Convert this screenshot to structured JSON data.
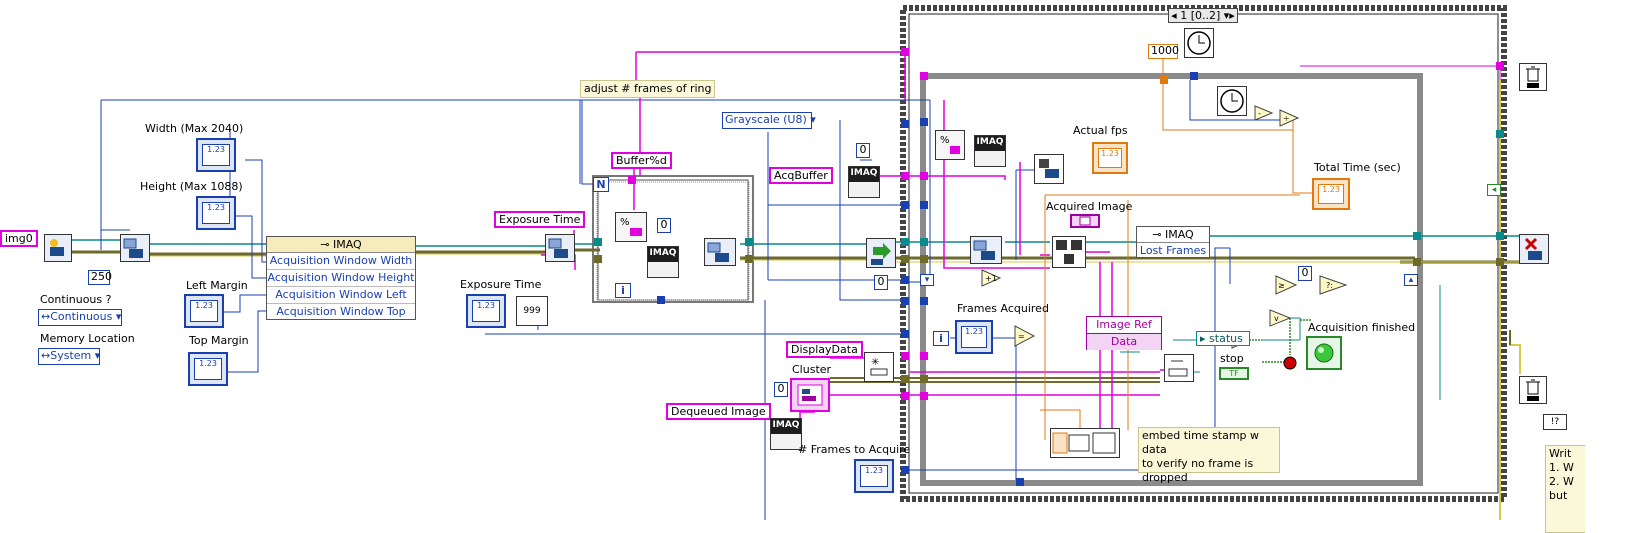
{
  "constants": {
    "img0": "img0",
    "n250": "250",
    "continuous": "Continuous",
    "memory": "System",
    "adjust_frames": "adjust # frames of ring",
    "buffer_fmt": "Buffer%d",
    "exposure_time_const": "Exposure Time",
    "grayscale": "Grayscale (U8)",
    "acq_buffer": "AcqBuffer",
    "display_data": "DisplayData",
    "dequeued_image": "Dequeued Image",
    "zero_a": "0",
    "zero_b": "0",
    "zero_c": "0",
    "zero_d": "0",
    "zero_e": "0",
    "n1000": "1000",
    "case_selector": "1 [0..2]",
    "stop_bool": "TF",
    "n999": "999"
  },
  "labels": {
    "width": "Width (Max 2040)",
    "height": "Height (Max 1088)",
    "left_margin": "Left Margin",
    "top_margin": "Top Margin",
    "continuous_q": "Continuous ?",
    "memory_location": "Memory Location",
    "exposure_time": "Exposure Time",
    "actual_fps": "Actual fps",
    "total_time": "Total Time (sec)",
    "acquired_image": "Acquired Image",
    "frames_acquired": "Frames Acquired",
    "acq_finished": "Acquisition finished",
    "stop": "stop",
    "status": "status",
    "cluster": "Cluster",
    "frames_to_acquire": "# Frames to Acquire"
  },
  "property_node": {
    "title": "IMAQ",
    "rows": [
      "Acquisition Window Width",
      "Acquisition Window Height",
      "Acquisition Window Left",
      "Acquisition Window Top"
    ]
  },
  "lost_frames_node": {
    "title": "IMAQ",
    "row": "Lost Frames"
  },
  "unbundle": {
    "image_ref": "Image Ref",
    "data": "Data"
  },
  "comments": {
    "timestamp": "embed time stamp w  data\nto verify no frame is\ndropped",
    "write_partial": "Writ\n1. W\n2. W\nbut"
  },
  "node_captions": {
    "imaq": "IMAQ",
    "n_terminal": "N",
    "i_terminal": "i"
  },
  "indicator_glyph": "1.23",
  "colors": {
    "blue_wire": "#1a3fb0",
    "pink_wire": "#e000e0",
    "orange_wire": "#e07a10",
    "teal_wire": "#0a8a8a",
    "gray_frame": "#8a8a8a",
    "green_led": "#3cc83c"
  }
}
